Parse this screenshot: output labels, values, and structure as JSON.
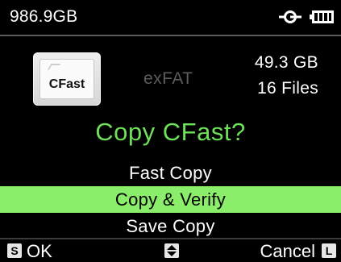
{
  "status": {
    "storage": "986.9GB",
    "icons": [
      "plug-icon",
      "battery-icon"
    ]
  },
  "card": {
    "label": "CFast",
    "filesystem": "exFAT",
    "size": "49.3 GB",
    "files": "16 Files"
  },
  "prompt": {
    "title": "Copy CFast?",
    "color": "#6fe05a"
  },
  "menu": {
    "items": [
      {
        "label": "Fast Copy"
      },
      {
        "label": "Copy & Verify"
      },
      {
        "label": "Save Copy"
      }
    ],
    "selected_index": 1,
    "highlight_color": "#8aee6a"
  },
  "softkeys": {
    "left": {
      "badge": "S",
      "label": "OK"
    },
    "right": {
      "badge": "L",
      "label": "Cancel"
    },
    "center_icon": "up-down-arrows-icon"
  }
}
